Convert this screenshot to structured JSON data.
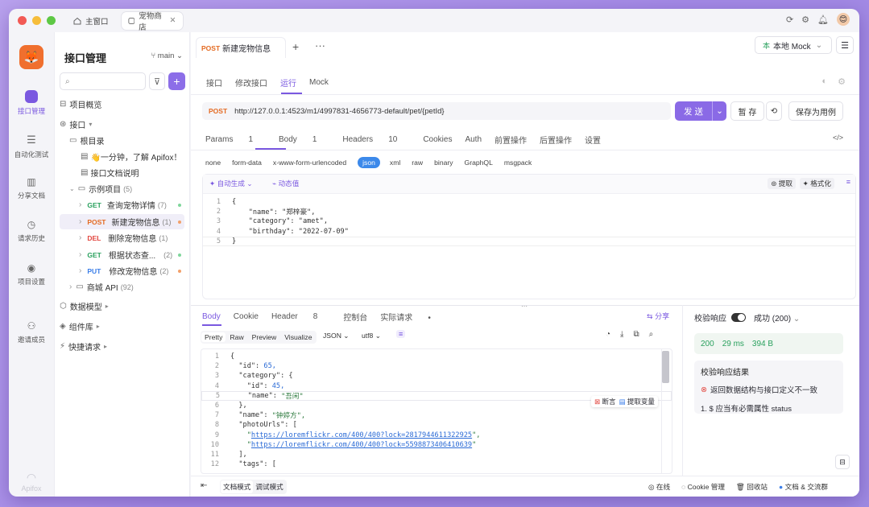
{
  "titlebar": {
    "tabs": [
      {
        "label": "主窗口"
      },
      {
        "label": "宠物商店"
      }
    ],
    "avatar": "😊"
  },
  "rail": {
    "items": [
      {
        "label": "接口管理"
      },
      {
        "label": "自动化测试"
      },
      {
        "label": "分享文档"
      },
      {
        "label": "请求历史"
      },
      {
        "label": "项目设置"
      },
      {
        "label": "邀请成员"
      }
    ],
    "brand": "Apifox"
  },
  "panel": {
    "title": "接口管理",
    "branch": "main",
    "search_placeholder": "",
    "tree": {
      "overview": "项目概览",
      "api": "接口",
      "root": "根目录",
      "doc1": "👋一分钟，了解 Apifox！",
      "doc2": "接口文档说明",
      "folder": "示例项目",
      "folder_count": "(5)",
      "items": [
        {
          "method": "GET",
          "name": "查询宠物详情",
          "count": "(7)"
        },
        {
          "method": "POST",
          "name": "新建宠物信息",
          "count": "(1)"
        },
        {
          "method": "DEL",
          "name": "删除宠物信息",
          "count": "(1)"
        },
        {
          "method": "GET",
          "name": "根据状态查...",
          "count": "(2)"
        },
        {
          "method": "PUT",
          "name": "修改宠物信息",
          "count": "(2)"
        }
      ],
      "mall": "商城 API",
      "mall_count": "(92)",
      "models": "数据模型",
      "components": "组件库",
      "quick": "快捷请求"
    }
  },
  "main": {
    "tab_method": "POST",
    "tab_title": "新建宠物信息",
    "env": "本地 Mock",
    "subtabs": [
      "接口",
      "修改接口",
      "运行",
      "Mock"
    ],
    "url_method": "POST",
    "url": "http://127.0.0.1:4523/m1/4997831-4656773-default/pet/{petId}",
    "send": "发 送",
    "save": "暂 存",
    "save_case": "保存为用例",
    "req_tabs": [
      {
        "label": "Params",
        "badge": "1"
      },
      {
        "label": "Body",
        "badge": "1"
      },
      {
        "label": "Headers",
        "badge": "10"
      },
      {
        "label": "Cookies"
      },
      {
        "label": "Auth"
      },
      {
        "label": "前置操作"
      },
      {
        "label": "后置操作"
      },
      {
        "label": "设置"
      }
    ],
    "body_types": [
      "none",
      "form-data",
      "x-www-form-urlencoded",
      "json",
      "xml",
      "raw",
      "binary",
      "GraphQL",
      "msgpack"
    ],
    "auto_gen": "自动生成",
    "dyn_val": "动态值",
    "extract": "提取",
    "format": "格式化",
    "req_code": [
      "{",
      "    \"name\": \"郑梓豪\",",
      "    \"category\": \"amet\",",
      "    \"birthday\": \"2022-07-09\"",
      "}"
    ],
    "resp_tabs": [
      {
        "label": "Body"
      },
      {
        "label": "Cookie"
      },
      {
        "label": "Header",
        "badge": "8"
      },
      {
        "label": "控制台"
      },
      {
        "label": "实际请求",
        "dot": "•"
      }
    ],
    "share": "分享",
    "view_modes": [
      "Pretty",
      "Raw",
      "Preview",
      "Visualize"
    ],
    "fmt": "JSON",
    "enc": "utf8",
    "resp_lines": [
      [
        "{",
        ""
      ],
      [
        "  \"id\": ",
        "65,"
      ],
      [
        "  \"category\": {",
        ""
      ],
      [
        "    \"id\": ",
        "45,"
      ],
      [
        "    \"name\": ",
        "\"吾闲\""
      ],
      [
        "  },",
        ""
      ],
      [
        "  \"name\": ",
        "\"钟婷方\","
      ],
      [
        "  \"photoUrls\": [",
        ""
      ],
      [
        "    ",
        "https://loremflickr.com/400/400?lock=2817944611322925"
      ],
      [
        "    ",
        "https://loremflickr.com/400/400?lock=5598873406410639"
      ],
      [
        "  ],",
        ""
      ],
      [
        "  \"tags\": [",
        ""
      ]
    ],
    "assert_label": "断言",
    "extract_var": "提取变量",
    "validate": "校验响应",
    "status_select": "成功 (200)",
    "stats": {
      "code": "200",
      "time": "29 ms",
      "size": "394 B"
    },
    "result_title": "校验响应结果",
    "result_err": "返回数据结构与接口定义不一致",
    "result_detail": "1. $ 应当有必需属性 status"
  },
  "statusbar": {
    "doc_mode": "文档模式",
    "debug_mode": "调试模式",
    "online": "在线",
    "cookie": "Cookie 管理",
    "recycle": "回收站",
    "community": "文档 & 交流群"
  }
}
